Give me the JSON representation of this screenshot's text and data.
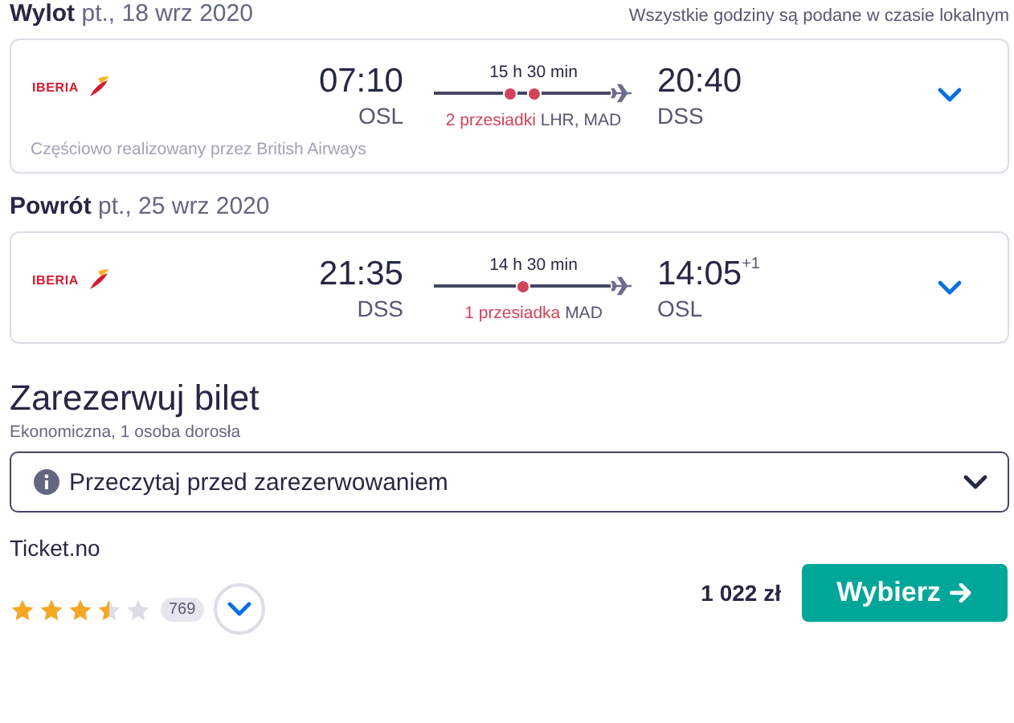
{
  "legs": [
    {
      "label": "Wylot",
      "date": "pt., 18 wrz 2020",
      "note": "Wszystkie godziny są podane w czasie lokalnym",
      "airline": "IBERIA",
      "dep_time": "07:10",
      "dep_airport": "OSL",
      "duration": "15 h 30 min",
      "stops_label": "2 przesiadki",
      "stops": [
        {
          "code": "LHR,"
        },
        {
          "code": "MAD"
        }
      ],
      "arr_time": "20:40",
      "arr_airport": "DSS",
      "operated_by": "Częściowo realizowany przez British Airways"
    },
    {
      "label": "Powrót",
      "date": "pt., 25 wrz 2020",
      "airline": "IBERIA",
      "dep_time": "21:35",
      "dep_airport": "DSS",
      "duration": "14 h 30 min",
      "stops_label": "1 przesiadka",
      "stops": [
        {
          "code": "MAD"
        }
      ],
      "arr_time": "14:05",
      "arr_day_offset": "+1",
      "arr_airport": "OSL"
    }
  ],
  "booking": {
    "title": "Zarezerwuj bilet",
    "subtitle": "Ekonomiczna, 1 osoba dorosła",
    "info": "Przeczytaj przed zarezerwowaniem",
    "provider": "Ticket.no",
    "stars": 3.5,
    "reviews": "769",
    "price": "1 022 zł",
    "button": "Wybierz"
  }
}
